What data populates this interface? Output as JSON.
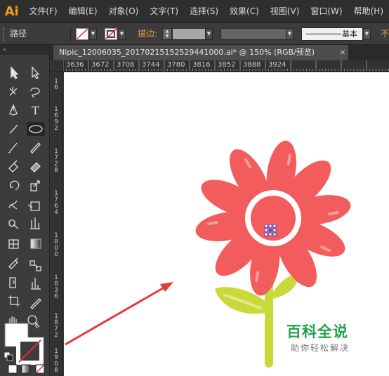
{
  "app": {
    "logo": "Ai",
    "accent": "#f6a013"
  },
  "menu": [
    {
      "label": "文件(F)"
    },
    {
      "label": "编辑(E)"
    },
    {
      "label": "对象(O)"
    },
    {
      "label": "文字(T)"
    },
    {
      "label": "选择(S)"
    },
    {
      "label": "效果(C)"
    },
    {
      "label": "视图(V)"
    },
    {
      "label": "窗口(W)"
    },
    {
      "label": "帮助(H)"
    }
  ],
  "control_bar": {
    "selection_label": "路径",
    "stroke_label": "描边:",
    "stroke_style": "基本",
    "opacity_label": "不"
  },
  "document": {
    "tab_title": "Nipic_12006035_20170215152529441000.ai* @ 150% (RGB/预览)",
    "close": "×"
  },
  "ruler_h": [
    "3636",
    "3672",
    "3708",
    "3744",
    "3780",
    "3816",
    "3852",
    "3888",
    "3924"
  ],
  "ruler_v": [
    "16",
    "1692",
    "1728",
    "1764",
    "1800",
    "1836",
    "1872",
    "1908"
  ],
  "watermark": {
    "title": "百科全说",
    "subtitle": "助你轻松解决"
  },
  "colors": {
    "petal": "#f25c5c",
    "stem": "#c9d93a",
    "arrow": "#e8393b",
    "canvas": "#ffffff"
  },
  "tools_icons": [
    "selection-tool",
    "direct-selection-tool",
    "magic-wand-tool",
    "lasso-tool",
    "pen-tool",
    "type-tool",
    "line-tool",
    "ellipse-tool",
    "paintbrush-tool",
    "pencil-tool",
    "blob-brush-tool",
    "eraser-tool",
    "rotate-tool",
    "scale-tool",
    "warp-tool",
    "free-transform-tool",
    "shape-builder-tool",
    "perspective-tool",
    "mesh-tool",
    "gradient-tool",
    "eyedropper-tool",
    "blend-tool",
    "symbol-sprayer-tool",
    "column-graph-tool",
    "artboard-tool",
    "slice-tool",
    "hand-tool",
    "zoom-tool"
  ]
}
